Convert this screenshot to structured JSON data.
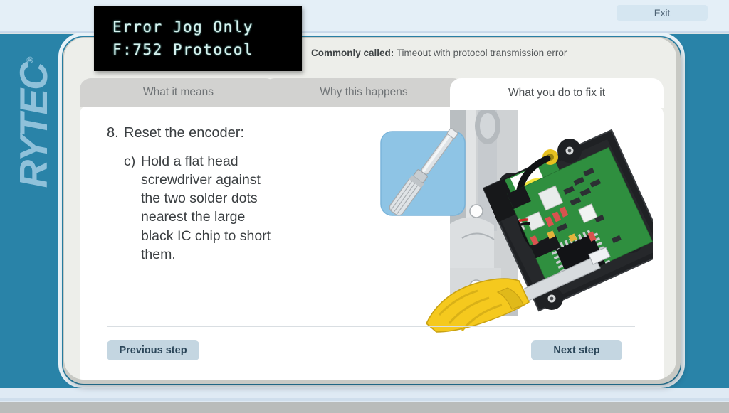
{
  "brand": {
    "logo_text": "RYTEC",
    "registered_mark": "®"
  },
  "topbar": {
    "exit_label": "Exit"
  },
  "lcd_display": {
    "line1": "Error Jog Only",
    "line2": "F:752 Protocol"
  },
  "header": {
    "commonly_called_label": "Commonly called:",
    "commonly_called_value": "Timeout with protocol transmission error"
  },
  "tabs": [
    {
      "label": "What it means",
      "active": false
    },
    {
      "label": "Why this happens",
      "active": false
    },
    {
      "label": "What you do to fix it",
      "active": true
    }
  ],
  "content": {
    "step_number": "8.",
    "step_title": "Reset the encoder:",
    "substep_letter": "c)",
    "substep_text": "Hold a flat head screwdriver against the two solder dots nearest the large black IC chip to short them."
  },
  "footer": {
    "previous_label": "Previous step",
    "next_label": "Next step"
  },
  "colors": {
    "teal_background": "#2983a8",
    "logo_blue": "#8fc1da",
    "card_background": "#edeeea",
    "panel_white": "#ffffff",
    "tab_inactive": "#d2d2d0",
    "button_blue": "#c4d6e1",
    "button_text": "#2b4659",
    "lcd_text": "#d8f2ef",
    "lcd_background": "#000000",
    "inset_blue": "#8ec4e5",
    "pcb_green": "#2f8f3f",
    "screwdriver_yellow": "#f5c91e"
  }
}
